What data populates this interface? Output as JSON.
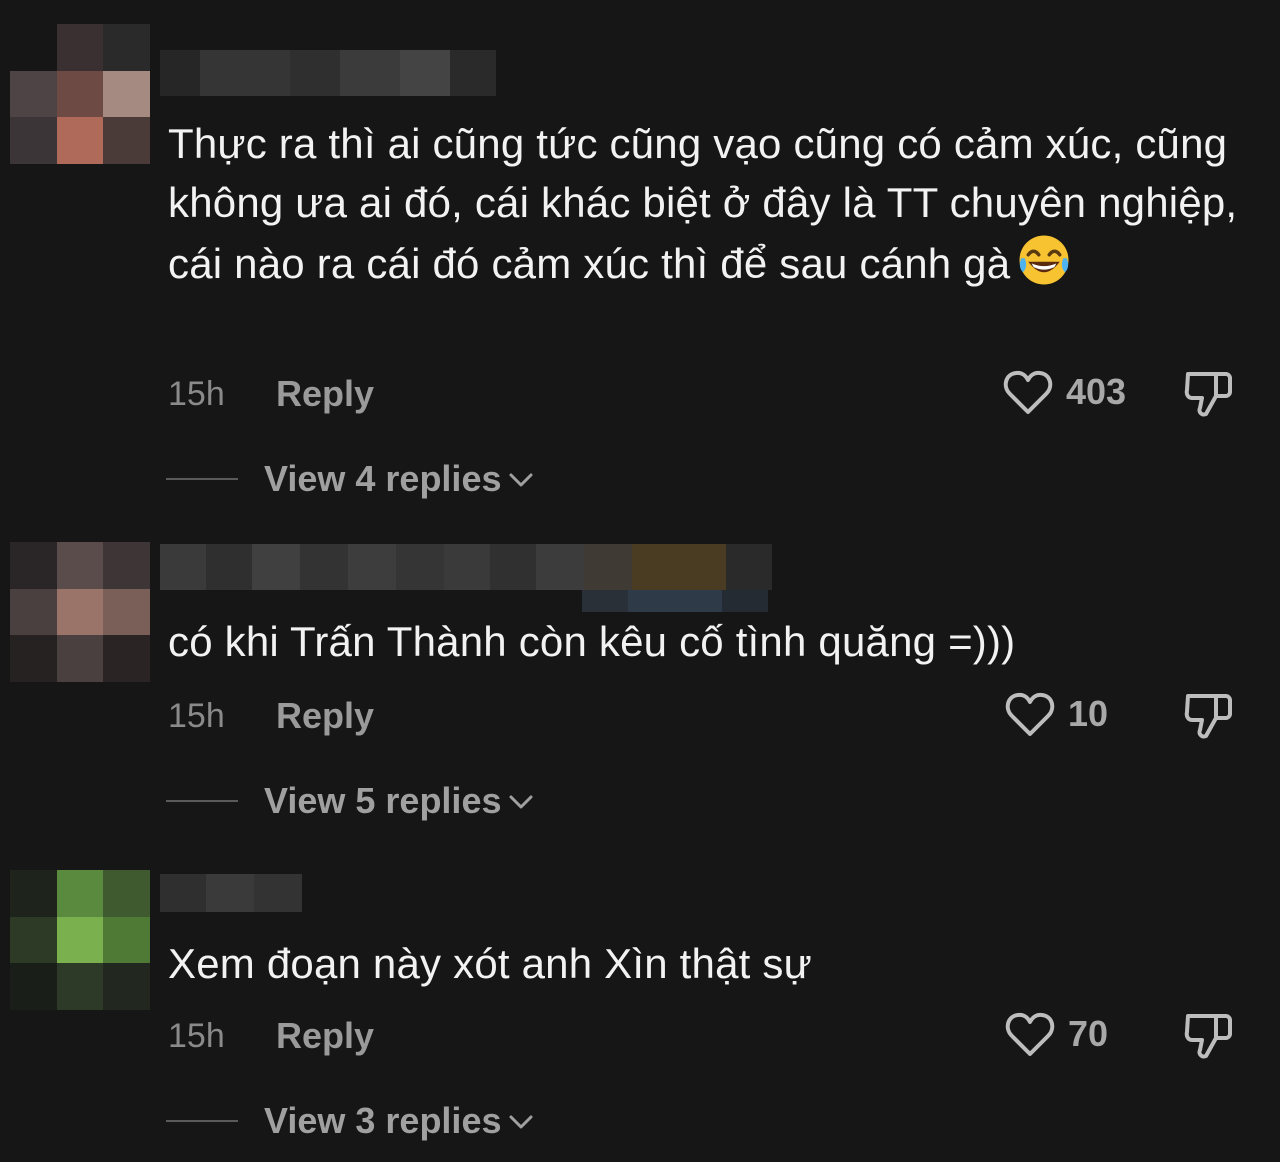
{
  "colors": {
    "background": "#161616",
    "text": "#f2f2f2",
    "muted": "#8a8a8a",
    "action": "#9a9a9a"
  },
  "comments": [
    {
      "text": "Thực ra thì ai cũng tức cũng vạo cũng có cảm xúc, cũng không ưa ai đó, cái khác biệt ở đây là TT chuyên nghiệp, cái nào ra cái đó cảm xúc thì để sau cánh gà",
      "emoji": "face-with-tears-of-joy",
      "time": "15h",
      "reply_label": "Reply",
      "likes": "403",
      "view_replies": "View 4 replies"
    },
    {
      "text": "có khi Trấn Thành còn kêu cố tình quăng =)))",
      "time": "15h",
      "reply_label": "Reply",
      "likes": "10",
      "view_replies": "View 5 replies"
    },
    {
      "text": "Xem đoạn này xót anh Xìn thật sự",
      "time": "15h",
      "reply_label": "Reply",
      "likes": "70",
      "view_replies": "View 3 replies"
    }
  ]
}
